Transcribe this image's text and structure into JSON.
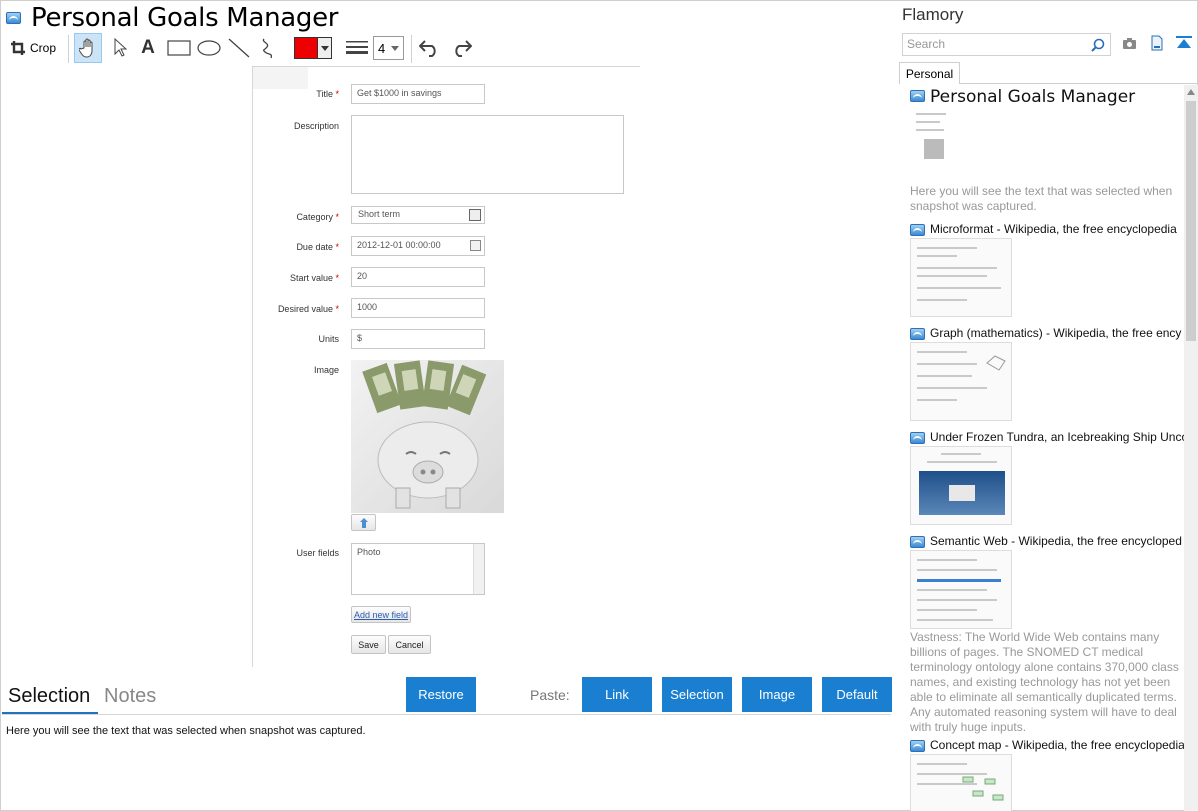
{
  "window": {
    "title": "Personal Goals Manager"
  },
  "toolbar": {
    "crop_label": "Crop",
    "text_tool_glyph": "A",
    "line_width_value": "4",
    "color": "#ee0000"
  },
  "form": {
    "title_label": "Title",
    "title_value": "Get $1000 in savings",
    "description_label": "Description",
    "category_label": "Category",
    "category_value": "Short term",
    "due_label": "Due date",
    "due_value": "2012-12-01 00:00:00",
    "start_label": "Start value",
    "start_value": "20",
    "desired_label": "Desired value",
    "desired_value": "1000",
    "units_label": "Units",
    "units_value": "$",
    "image_label": "Image",
    "user_fields_label": "User fields",
    "user_fields_value": "Photo",
    "add_field": "Add new field",
    "save": "Save",
    "cancel": "Cancel",
    "required_mark": "*"
  },
  "bottom": {
    "tab_selection": "Selection",
    "tab_notes": "Notes",
    "restore": "Restore",
    "paste_label": "Paste:",
    "link": "Link",
    "selection": "Selection",
    "image": "Image",
    "default": "Default",
    "selection_text": "Here you will see the text that was selected when snapshot was captured."
  },
  "panel": {
    "title": "Flamory",
    "search_placeholder": "Search",
    "tab": "Personal",
    "items": [
      {
        "title": "Personal Goals Manager",
        "snippet": "Here you will see the text that was selected when snapshot was captured."
      },
      {
        "title": "Microformat - Wikipedia, the free encyclopedia"
      },
      {
        "title": "Graph (mathematics) - Wikipedia, the free ency"
      },
      {
        "title": "Under Frozen Tundra, an Icebreaking Ship Unco"
      },
      {
        "title": "Semantic Web - Wikipedia, the free encycloped",
        "snippet": "Vastness: The World Wide Web contains many billions of pages. The SNOMED CT medical terminology ontology alone contains 370,000 class names, and existing technology has not yet been able to eliminate all semantically duplicated terms. Any automated reasoning system will have to deal with truly huge inputs."
      },
      {
        "title": "Concept map - Wikipedia, the free encyclopedia"
      }
    ]
  },
  "colors": {
    "accent": "#1a7fd1",
    "required": "#cc0000"
  }
}
